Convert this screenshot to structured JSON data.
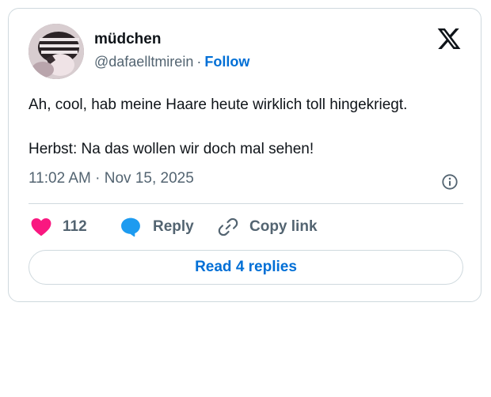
{
  "author": {
    "display_name": "müdchen",
    "handle": "@dafaelltmirein",
    "separator": "·",
    "follow_label": "Follow"
  },
  "tweet": {
    "line1": "Ah, cool, hab meine Haare heute wirklich toll hingekriegt.",
    "line2": "Herbst: Na das wollen wir doch mal sehen!",
    "timestamp": "11:02 AM · Nov 15, 2025"
  },
  "actions": {
    "like_count": "112",
    "reply_label": "Reply",
    "copy_link_label": "Copy link"
  },
  "read_replies_label": "Read 4 replies",
  "colors": {
    "like": "#f91880",
    "reply": "#1d9bf0",
    "link": "#006fd6",
    "muted": "#536471",
    "border": "#cfd9de"
  },
  "icons": {
    "logo": "x-logo-icon",
    "info": "info-icon",
    "like": "heart-icon",
    "reply": "speech-bubble-icon",
    "copy": "link-icon"
  }
}
